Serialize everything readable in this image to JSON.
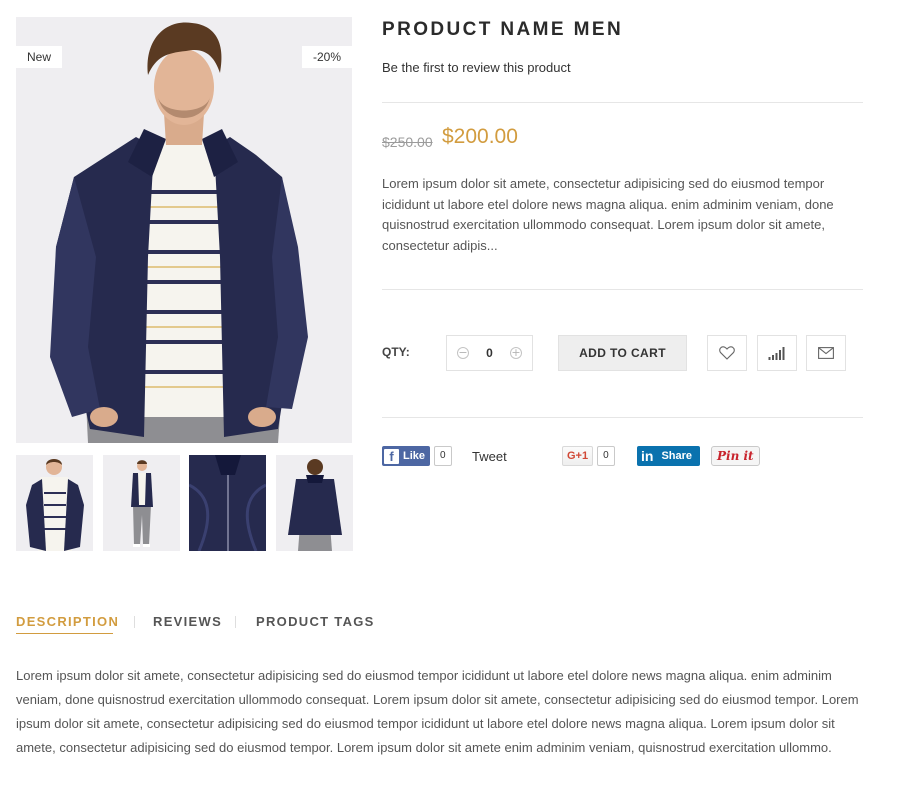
{
  "product": {
    "title": "PRODUCT NAME MEN",
    "review_link": "Be the first to review this product",
    "old_price": "$250.00",
    "new_price": "$200.00",
    "short_description": "Lorem ipsum dolor sit amete, consectetur adipisicing sed do eiusmod tempor icididunt ut labore etel dolore news magna aliqua. enim adminim veniam, done quisnostrud exercitation ullommodo consequat. Lorem ipsum dolor sit amete, consectetur adipis..."
  },
  "badges": {
    "new": "New",
    "sale": "-20%"
  },
  "purchase": {
    "qty_label": "QTY:",
    "qty_value": "0",
    "minus_symbol": "⊖",
    "plus_symbol": "⊕",
    "add_to_cart": "ADD TO CART",
    "icons": [
      "heart-icon",
      "compare-bars-icon",
      "envelope-icon"
    ]
  },
  "social": {
    "fb_letter": "f",
    "fb_like": "Like",
    "fb_count": "0",
    "tweet": "Tweet",
    "gplus": "G+1",
    "gplus_count": "0",
    "linkedin_in": "in",
    "linkedin_share": "Share",
    "pinterest": "Pin it"
  },
  "tabs": [
    {
      "label": "DESCRIPTION",
      "active": true
    },
    {
      "label": "REVIEWS",
      "active": false
    },
    {
      "label": "PRODUCT TAGS",
      "active": false
    }
  ],
  "tab_content": "Lorem ipsum dolor sit amete, consectetur adipisicing sed do eiusmod tempor icididunt ut labore etel dolore news magna aliqua. enim adminim veniam, done quisnostrud exercitation ullommodo consequat. Lorem ipsum dolor sit amete, consectetur adipisicing sed do eiusmod tempor. Lorem ipsum dolor sit amete, consectetur adipisicing sed do eiusmod tempor icididunt ut labore etel dolore news magna aliqua. Lorem ipsum dolor sit amete, consectetur adipisicing sed do eiusmod tempor. Lorem ipsum dolor sit amete enim adminim veniam, quisnostrud exercitation ullommo.",
  "colors": {
    "accent": "#d29c3f",
    "jacket": "#262a4e",
    "facebook": "#4d67a3",
    "linkedin": "#0a72ae",
    "pinterest": "#c8232c"
  }
}
